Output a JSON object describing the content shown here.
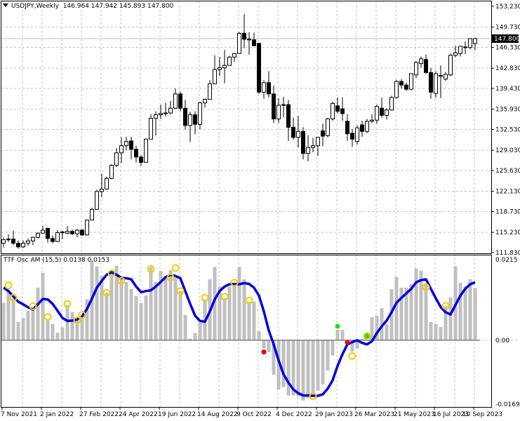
{
  "header": {
    "symbol": "USDJPY,Weekly",
    "open": "146.964",
    "high": "147.942",
    "low": "145.893",
    "close": "147.800"
  },
  "indicator": {
    "name": "TTF Osc AM (15,5)",
    "value1": "0.0138",
    "value2": "0.0153"
  },
  "current_price_label": "147.800",
  "colors": {
    "bull_body": "#ffffff",
    "bear_body": "#000000",
    "histogram": "#c0c0c0",
    "signal_line": "#0000e0",
    "circle": "#f0d000",
    "buy_dot": "#22dd22",
    "sell_dot": "#ee0000",
    "grid": "#c0c0c0"
  },
  "chart_data": [
    {
      "type": "candlestick",
      "title": "USDJPY,Weekly",
      "ylim": [
        111.83,
        153.23
      ],
      "y_ticks": [
        "153.230",
        "149.730",
        "146.330",
        "142.830",
        "139.430",
        "135.930",
        "132.530",
        "129.030",
        "125.630",
        "122.130",
        "118.730",
        "115.230",
        "111.830"
      ],
      "x_ticks": [
        "7 Nov 2021",
        "2 Jan 2022",
        "27 Feb 2022",
        "24 Apr 2022",
        "19 Jun 2022",
        "14 Aug 2022",
        "9 Oct 2022",
        "4 Dec 2022",
        "29 Jan 2023",
        "26 Mar 2023",
        "21 May 2023",
        "16 Jul 2023",
        "10 Sep 2023"
      ],
      "x_tick_every": 8,
      "ohlc": [
        [
          113.4,
          114.3,
          112.7,
          114.0
        ],
        [
          114.0,
          114.9,
          113.6,
          114.1
        ],
        [
          114.1,
          115.5,
          113.1,
          113.4
        ],
        [
          113.4,
          113.9,
          112.5,
          112.8
        ],
        [
          112.8,
          113.9,
          112.6,
          113.4
        ],
        [
          113.4,
          114.2,
          113.0,
          113.8
        ],
        [
          113.8,
          114.5,
          113.1,
          114.4
        ],
        [
          114.4,
          115.2,
          114.2,
          115.1
        ],
        [
          115.1,
          116.3,
          115.0,
          115.6
        ],
        [
          115.9,
          116.0,
          113.5,
          114.2
        ],
        [
          114.2,
          114.7,
          113.4,
          113.7
        ],
        [
          113.7,
          115.6,
          113.6,
          115.2
        ],
        [
          115.2,
          115.5,
          114.1,
          115.3
        ],
        [
          115.1,
          116.3,
          114.9,
          115.4
        ],
        [
          115.4,
          115.7,
          114.8,
          115.0
        ],
        [
          115.0,
          115.8,
          114.4,
          115.6
        ],
        [
          115.6,
          115.8,
          114.6,
          114.8
        ],
        [
          114.8,
          117.4,
          114.7,
          117.3
        ],
        [
          117.3,
          119.4,
          117.3,
          119.1
        ],
        [
          119.1,
          122.4,
          119.1,
          122.1
        ],
        [
          122.1,
          125.1,
          121.2,
          122.5
        ],
        [
          122.5,
          124.6,
          122.4,
          124.3
        ],
        [
          124.3,
          126.7,
          124.2,
          126.5
        ],
        [
          126.5,
          129.4,
          126.2,
          128.6
        ],
        [
          128.6,
          131.2,
          126.9,
          129.8
        ],
        [
          129.8,
          131.3,
          129.0,
          130.5
        ],
        [
          130.6,
          131.3,
          127.5,
          129.2
        ],
        [
          129.2,
          129.8,
          127.0,
          127.9
        ],
        [
          127.9,
          128.2,
          126.4,
          127.0
        ],
        [
          127.0,
          131.0,
          127.0,
          130.9
        ],
        [
          130.9,
          135.1,
          130.9,
          134.4
        ],
        [
          134.4,
          135.6,
          131.5,
          135.0
        ],
        [
          135.0,
          136.7,
          134.3,
          135.2
        ],
        [
          135.2,
          137.0,
          134.7,
          135.3
        ],
        [
          135.3,
          137.3,
          135.1,
          136.1
        ],
        [
          136.1,
          139.4,
          136.0,
          138.5
        ],
        [
          138.5,
          138.9,
          135.6,
          136.1
        ],
        [
          136.1,
          137.5,
          132.5,
          133.2
        ],
        [
          133.2,
          135.5,
          130.4,
          135.0
        ],
        [
          135.0,
          135.6,
          131.7,
          133.4
        ],
        [
          133.4,
          137.2,
          132.6,
          137.0
        ],
        [
          137.0,
          137.7,
          136.2,
          137.6
        ],
        [
          137.6,
          140.8,
          137.6,
          140.2
        ],
        [
          140.2,
          145.0,
          140.2,
          142.6
        ],
        [
          142.6,
          144.7,
          141.5,
          142.9
        ],
        [
          142.9,
          145.9,
          140.3,
          143.3
        ],
        [
          143.3,
          144.9,
          143.3,
          144.7
        ],
        [
          144.7,
          145.4,
          143.9,
          145.3
        ],
        [
          145.3,
          148.9,
          145.3,
          148.7
        ],
        [
          148.7,
          151.9,
          146.2,
          147.7
        ],
        [
          147.7,
          148.9,
          145.1,
          147.6
        ],
        [
          147.6,
          148.8,
          146.7,
          146.6
        ],
        [
          147.0,
          147.1,
          138.5,
          138.8
        ],
        [
          138.8,
          140.8,
          137.7,
          140.4
        ],
        [
          140.4,
          142.3,
          137.9,
          138.5
        ],
        [
          138.5,
          139.9,
          133.6,
          134.3
        ],
        [
          134.3,
          137.8,
          133.6,
          136.6
        ],
        [
          136.6,
          138.0,
          134.6,
          136.7
        ],
        [
          136.7,
          137.5,
          130.6,
          132.9
        ],
        [
          132.9,
          134.5,
          130.8,
          131.2
        ],
        [
          131.2,
          134.8,
          129.5,
          132.2
        ],
        [
          132.2,
          132.9,
          127.5,
          128.5
        ],
        [
          128.5,
          131.6,
          127.2,
          129.5
        ],
        [
          129.5,
          131.1,
          128.7,
          129.8
        ],
        [
          129.8,
          131.2,
          128.1,
          131.2
        ],
        [
          132.3,
          133.5,
          129.7,
          131.4
        ],
        [
          131.5,
          134.5,
          131.2,
          134.3
        ],
        [
          134.3,
          137.2,
          134.0,
          136.9
        ],
        [
          136.5,
          137.9,
          135.2,
          135.6
        ],
        [
          136.0,
          137.9,
          134.0,
          135.2
        ],
        [
          133.9,
          135.1,
          130.6,
          131.8
        ],
        [
          131.9,
          132.6,
          129.6,
          130.9
        ],
        [
          130.5,
          133.2,
          130.0,
          132.8
        ],
        [
          133.3,
          134.0,
          131.3,
          132.2
        ],
        [
          132.2,
          134.3,
          131.9,
          133.9
        ],
        [
          133.9,
          135.1,
          133.6,
          134.1
        ],
        [
          134.1,
          136.7,
          133.5,
          136.4
        ],
        [
          136.1,
          137.9,
          134.5,
          134.9
        ],
        [
          134.9,
          136.1,
          134.2,
          135.8
        ],
        [
          135.8,
          138.2,
          135.7,
          137.9
        ],
        [
          137.9,
          140.9,
          137.7,
          140.6
        ],
        [
          140.6,
          141.0,
          139.4,
          140.0
        ],
        [
          140.0,
          140.4,
          139.0,
          139.3
        ],
        [
          139.3,
          142.0,
          139.1,
          141.9
        ],
        [
          141.7,
          144.0,
          141.2,
          143.8
        ],
        [
          143.6,
          144.8,
          142.9,
          144.4
        ],
        [
          144.3,
          145.1,
          141.9,
          142.1
        ],
        [
          142.1,
          142.9,
          137.7,
          138.8
        ],
        [
          138.6,
          142.3,
          137.9,
          141.9
        ],
        [
          141.6,
          143.3,
          137.8,
          141.5
        ],
        [
          141.0,
          142.2,
          140.7,
          141.8
        ],
        [
          141.7,
          145.3,
          141.5,
          145.0
        ],
        [
          145.0,
          146.6,
          144.7,
          145.4
        ],
        [
          145.3,
          146.6,
          144.8,
          146.5
        ],
        [
          146.4,
          147.3,
          145.2,
          146.4
        ],
        [
          146.3,
          147.9,
          146.0,
          147.8
        ],
        [
          146.964,
          147.942,
          145.893,
          147.8
        ]
      ],
      "current_price": 147.8
    },
    {
      "type": "bar+line",
      "title": "TTF Osc AM (15,5)",
      "ylim": [
        -0.0169,
        0.0215
      ],
      "y_ticks": [
        "0.0215",
        "0.00",
        "-0.0169"
      ],
      "histogram": [
        0.0099,
        0.013,
        0.0111,
        0.0048,
        0.0059,
        0.0078,
        0.0087,
        0.0139,
        0.0178,
        0.0052,
        0.0043,
        0.002,
        0.0034,
        0.0093,
        0.0074,
        0.0052,
        0.0061,
        0.0108,
        0.021,
        0.0195,
        0.017,
        0.0126,
        0.0176,
        0.0197,
        0.0163,
        0.0154,
        0.0136,
        0.0117,
        0.0098,
        0.0118,
        0.0193,
        0.0154,
        0.0183,
        0.017,
        0.0185,
        0.0165,
        0.013,
        0.0067,
        0.0004,
        0.0019,
        0.0046,
        0.0108,
        0.0161,
        0.0194,
        0.0142,
        0.0111,
        0.0142,
        0.0152,
        0.0194,
        0.0161,
        0.0102,
        0.0102,
        0.0024,
        -0.0022,
        -0.0031,
        -0.0091,
        -0.013,
        -0.0124,
        -0.0146,
        -0.0146,
        -0.0148,
        -0.0159,
        -0.0152,
        -0.0146,
        -0.0133,
        -0.0117,
        -0.008,
        -0.004,
        0.0028,
        0.0027,
        0.0002,
        -0.003,
        -0.0022,
        0.0003,
        0.0019,
        0.0061,
        0.0065,
        0.0085,
        0.0043,
        0.0135,
        0.0167,
        0.0139,
        0.0139,
        0.0148,
        0.0189,
        0.0184,
        0.0148,
        0.0048,
        0.0043,
        0.0035,
        0.009,
        0.0113,
        0.0196,
        0.0152,
        0.0143,
        0.0161,
        0.0138
      ],
      "signal": [
        0.0139,
        0.013,
        0.0116,
        0.0102,
        0.0095,
        0.0087,
        0.0081,
        0.0095,
        0.0109,
        0.0108,
        0.0096,
        0.0078,
        0.0059,
        0.0051,
        0.0052,
        0.0055,
        0.0063,
        0.0083,
        0.011,
        0.0139,
        0.0157,
        0.0173,
        0.018,
        0.0173,
        0.0165,
        0.0164,
        0.0161,
        0.0142,
        0.0127,
        0.013,
        0.0132,
        0.0142,
        0.0154,
        0.0167,
        0.0173,
        0.017,
        0.0164,
        0.013,
        0.0096,
        0.0065,
        0.0051,
        0.0049,
        0.0076,
        0.0108,
        0.013,
        0.0142,
        0.0148,
        0.0149,
        0.0148,
        0.0151,
        0.0149,
        0.0139,
        0.0118,
        0.0076,
        0.0026,
        -0.0011,
        -0.0053,
        -0.009,
        -0.0112,
        -0.013,
        -0.014,
        -0.0146,
        -0.0146,
        -0.0147,
        -0.0147,
        -0.0143,
        -0.0128,
        -0.0106,
        -0.0068,
        -0.0037,
        -0.0011,
        -0.0005,
        0.0,
        -0.0007,
        -0.0011,
        -0.0003,
        0.0019,
        0.0037,
        0.0052,
        0.0074,
        0.0099,
        0.0112,
        0.0124,
        0.0136,
        0.0153,
        0.0159,
        0.0161,
        0.0136,
        0.0111,
        0.0088,
        0.0074,
        0.0068,
        0.0093,
        0.0118,
        0.0136,
        0.0148,
        0.0153
      ],
      "circles": [
        [
          1,
          0.0145
        ],
        [
          2,
          0.0112
        ],
        [
          6,
          0.009
        ],
        [
          9,
          0.0062
        ],
        [
          13,
          0.0096
        ],
        [
          15,
          0.0053
        ],
        [
          16,
          0.0067
        ],
        [
          21,
          0.0125
        ],
        [
          22,
          0.0177
        ],
        [
          24,
          0.0157
        ],
        [
          30,
          0.0188
        ],
        [
          34,
          0.0166
        ],
        [
          35,
          0.0191
        ],
        [
          36,
          0.013
        ],
        [
          41,
          0.0112
        ],
        [
          45,
          0.0115
        ],
        [
          47,
          0.0152
        ],
        [
          50,
          0.0105
        ],
        [
          63,
          -0.0148
        ],
        [
          71,
          -0.0042
        ],
        [
          74,
          0.0011
        ],
        [
          86,
          0.014
        ],
        [
          90,
          0.0091
        ]
      ],
      "buy_dots": [
        [
          68,
          0.0037
        ],
        [
          74,
          0.0011
        ]
      ],
      "sell_dots": [
        [
          53,
          -0.0031
        ],
        [
          70,
          -0.0006
        ]
      ]
    }
  ]
}
